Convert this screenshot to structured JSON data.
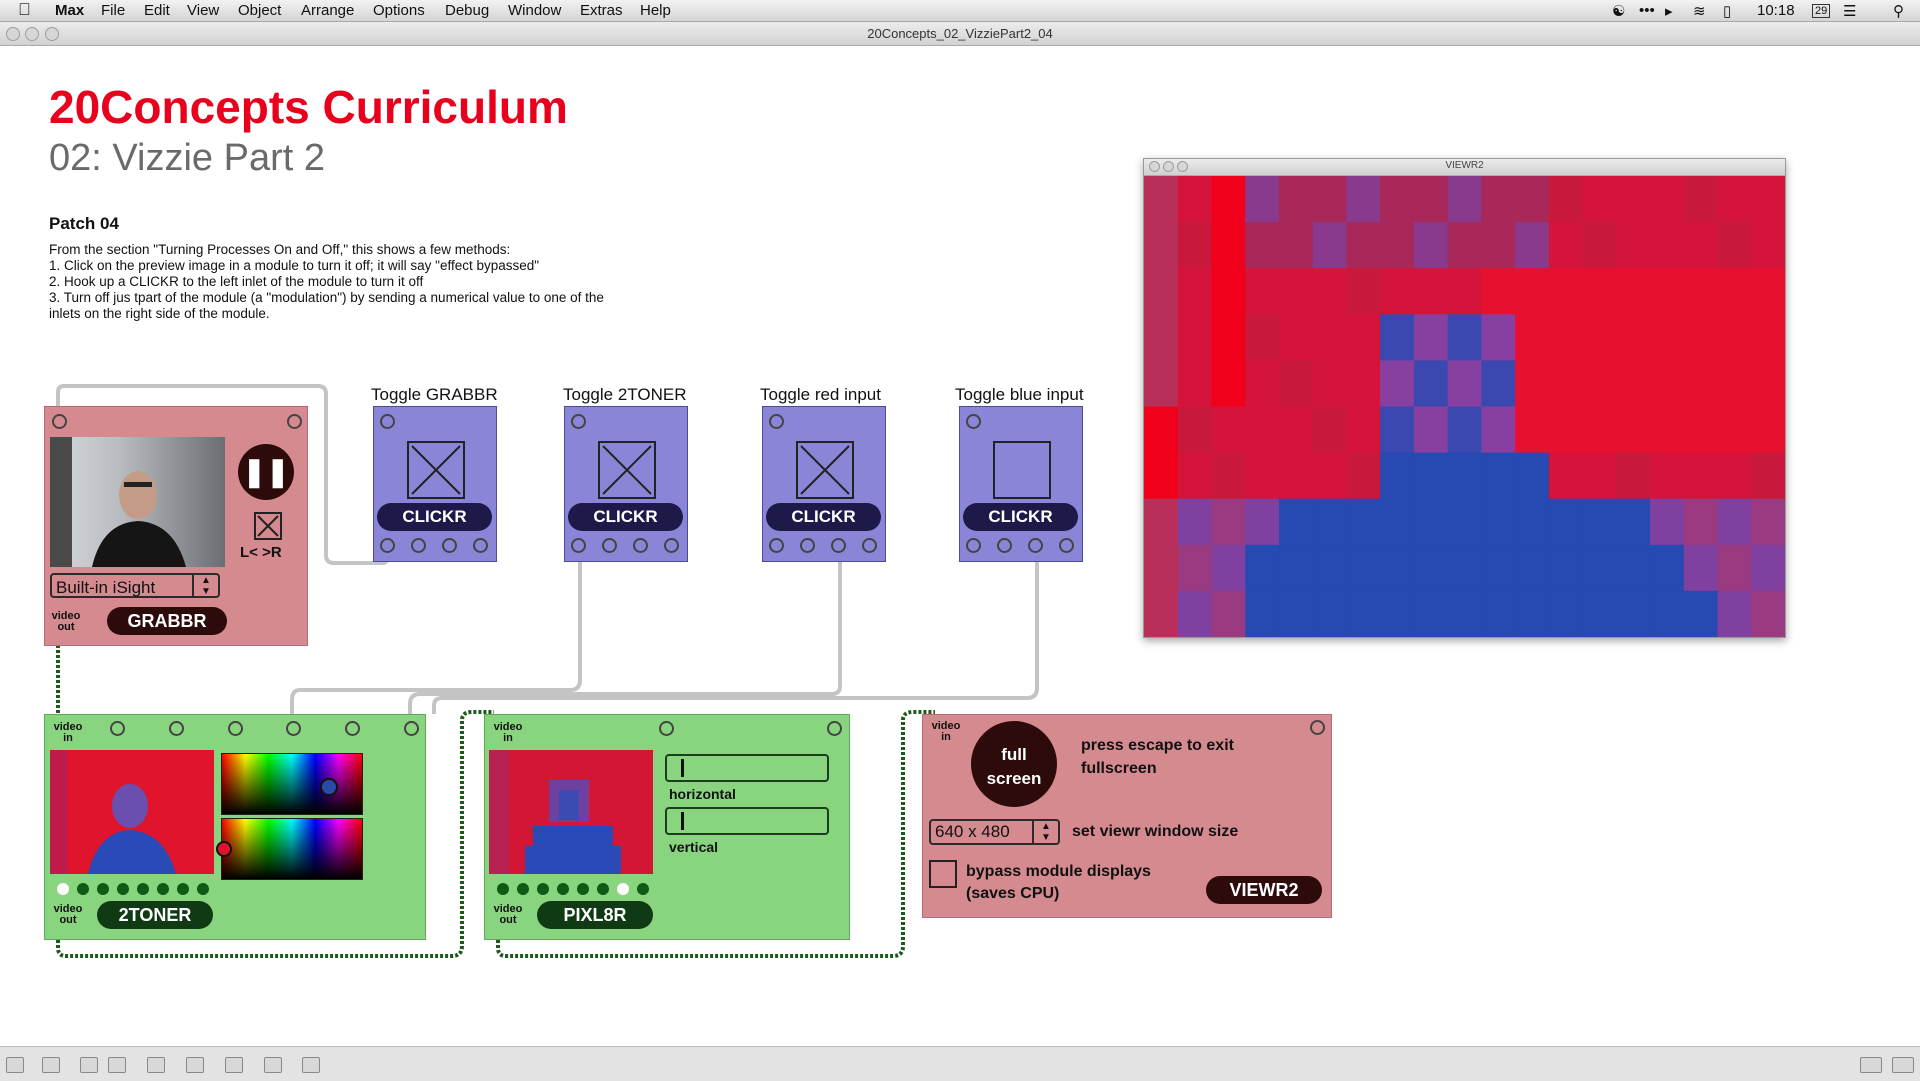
{
  "menubar": {
    "apple": "",
    "app": "Max",
    "items": [
      "File",
      "Edit",
      "View",
      "Object",
      "Arrange",
      "Options",
      "Debug",
      "Window",
      "Extras",
      "Help"
    ],
    "clock": "10:18",
    "calendar_day": "29"
  },
  "window": {
    "title": "20Concepts_02_VizziePart2_04"
  },
  "header": {
    "title": "20Concepts Curriculum",
    "subtitle": "02: Vizzie Part 2",
    "patch": "Patch 04",
    "description": [
      "From the section \"Turning Processes On and Off,\" this shows a few methods:",
      "1. Click on the preview image in a module to turn it off; it will say \"effect bypassed\"",
      "2. Hook up a CLICKR to the left inlet of the module to turn it off",
      "3. Turn off jus tpart of the module (a \"modulation\") by sending a numerical value to one of the",
      "inlets on the right side of the module."
    ]
  },
  "grabbr": {
    "name": "GRABBR",
    "device": "Built-in iSight",
    "lr": "L< >R",
    "out_label": "video out"
  },
  "toggles": [
    {
      "label": "Toggle GRABBR",
      "button": "CLICKR",
      "checked": true
    },
    {
      "label": "Toggle 2TONER",
      "button": "CLICKR",
      "checked": true
    },
    {
      "label": "Toggle red input",
      "button": "CLICKR",
      "checked": true
    },
    {
      "label": "Toggle blue input",
      "button": "CLICKR",
      "checked": false
    }
  ],
  "twotoner": {
    "name": "2TONER",
    "in_label": "video in",
    "out_label": "video out"
  },
  "pixl8r": {
    "name": "PIXL8R",
    "in_label": "video in",
    "out_label": "video out",
    "slider1": "horizontal",
    "slider2": "vertical"
  },
  "viewr2": {
    "name": "VIEWR2",
    "in_label": "video in",
    "fullscreen": [
      "full",
      "screen"
    ],
    "escape_note": [
      "press escape to exit",
      "fullscreen"
    ],
    "size": "640 x 480",
    "size_label": "set viewr window size",
    "bypass_label": [
      "bypass module displays",
      "(saves CPU)"
    ]
  },
  "viewer_window": {
    "title": "VIEWR2"
  },
  "colors": {
    "title_red": "#e8001c",
    "pink_module": "#d48a8e",
    "green_module": "#89d47e",
    "purple_module": "#8a85d6"
  }
}
